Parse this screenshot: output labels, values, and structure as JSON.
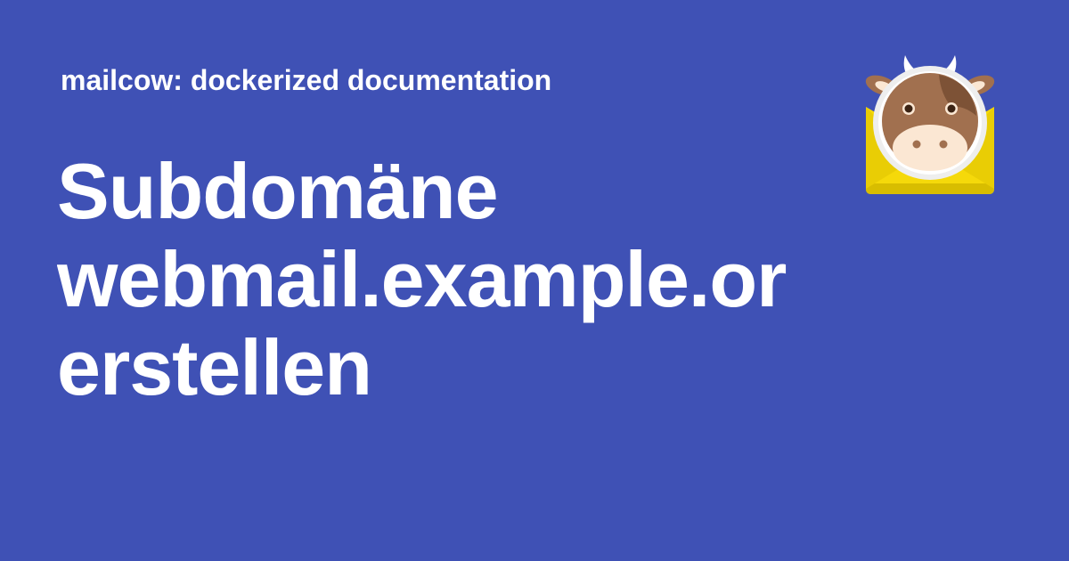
{
  "site": {
    "name": "mailcow: dockerized documentation"
  },
  "page": {
    "title_lines": [
      "Subdomäne",
      "webmail.example.org",
      "erstellen"
    ]
  },
  "logo": {
    "icon": "mailcow-cow-envelope-icon"
  },
  "colors": {
    "background": "#3f51b5",
    "text": "#ffffff",
    "envelope": "#f5d90a",
    "cow_brown": "#a1704f",
    "cow_muzzle": "#fbe7d3"
  }
}
